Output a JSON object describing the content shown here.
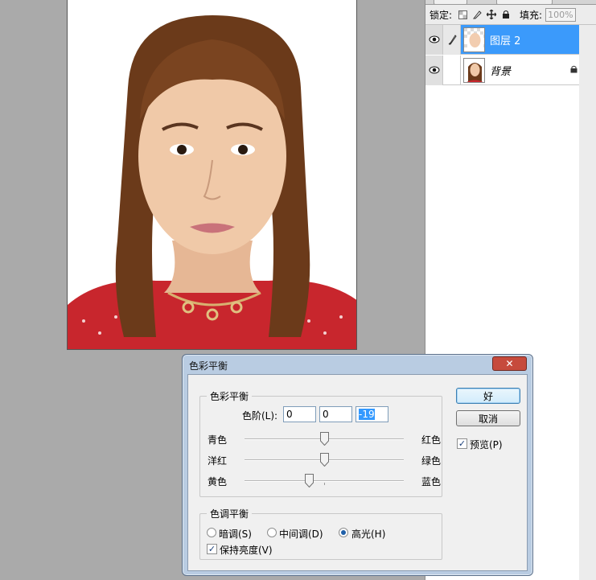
{
  "layers_panel": {
    "lock_label": "锁定:",
    "fill_label": "填充:",
    "fill_value": "100%",
    "layers": [
      {
        "name": "图层 2",
        "selected": true,
        "visible": true
      },
      {
        "name": "背景",
        "selected": false,
        "visible": true,
        "locked": true
      }
    ]
  },
  "dialog": {
    "title": "色彩平衡",
    "close_label": "✕",
    "balance_group": {
      "legend": "色彩平衡",
      "levels_label": "色阶(L):",
      "level_values": [
        "0",
        "0",
        "-19"
      ],
      "sliders": [
        {
          "left": "青色",
          "right": "红色",
          "value": 0
        },
        {
          "left": "洋红",
          "right": "绿色",
          "value": 0
        },
        {
          "left": "黄色",
          "right": "蓝色",
          "value": -19
        }
      ]
    },
    "tone_group": {
      "legend": "色调平衡",
      "options": [
        {
          "label": "暗调(S)",
          "checked": false
        },
        {
          "label": "中间调(D)",
          "checked": false
        },
        {
          "label": "高光(H)",
          "checked": true
        }
      ],
      "preserve_label": "保持亮度(V)",
      "preserve_checked": true
    },
    "ok_label": "好",
    "cancel_label": "取消",
    "preview_label": "预览(P)",
    "preview_checked": true
  }
}
